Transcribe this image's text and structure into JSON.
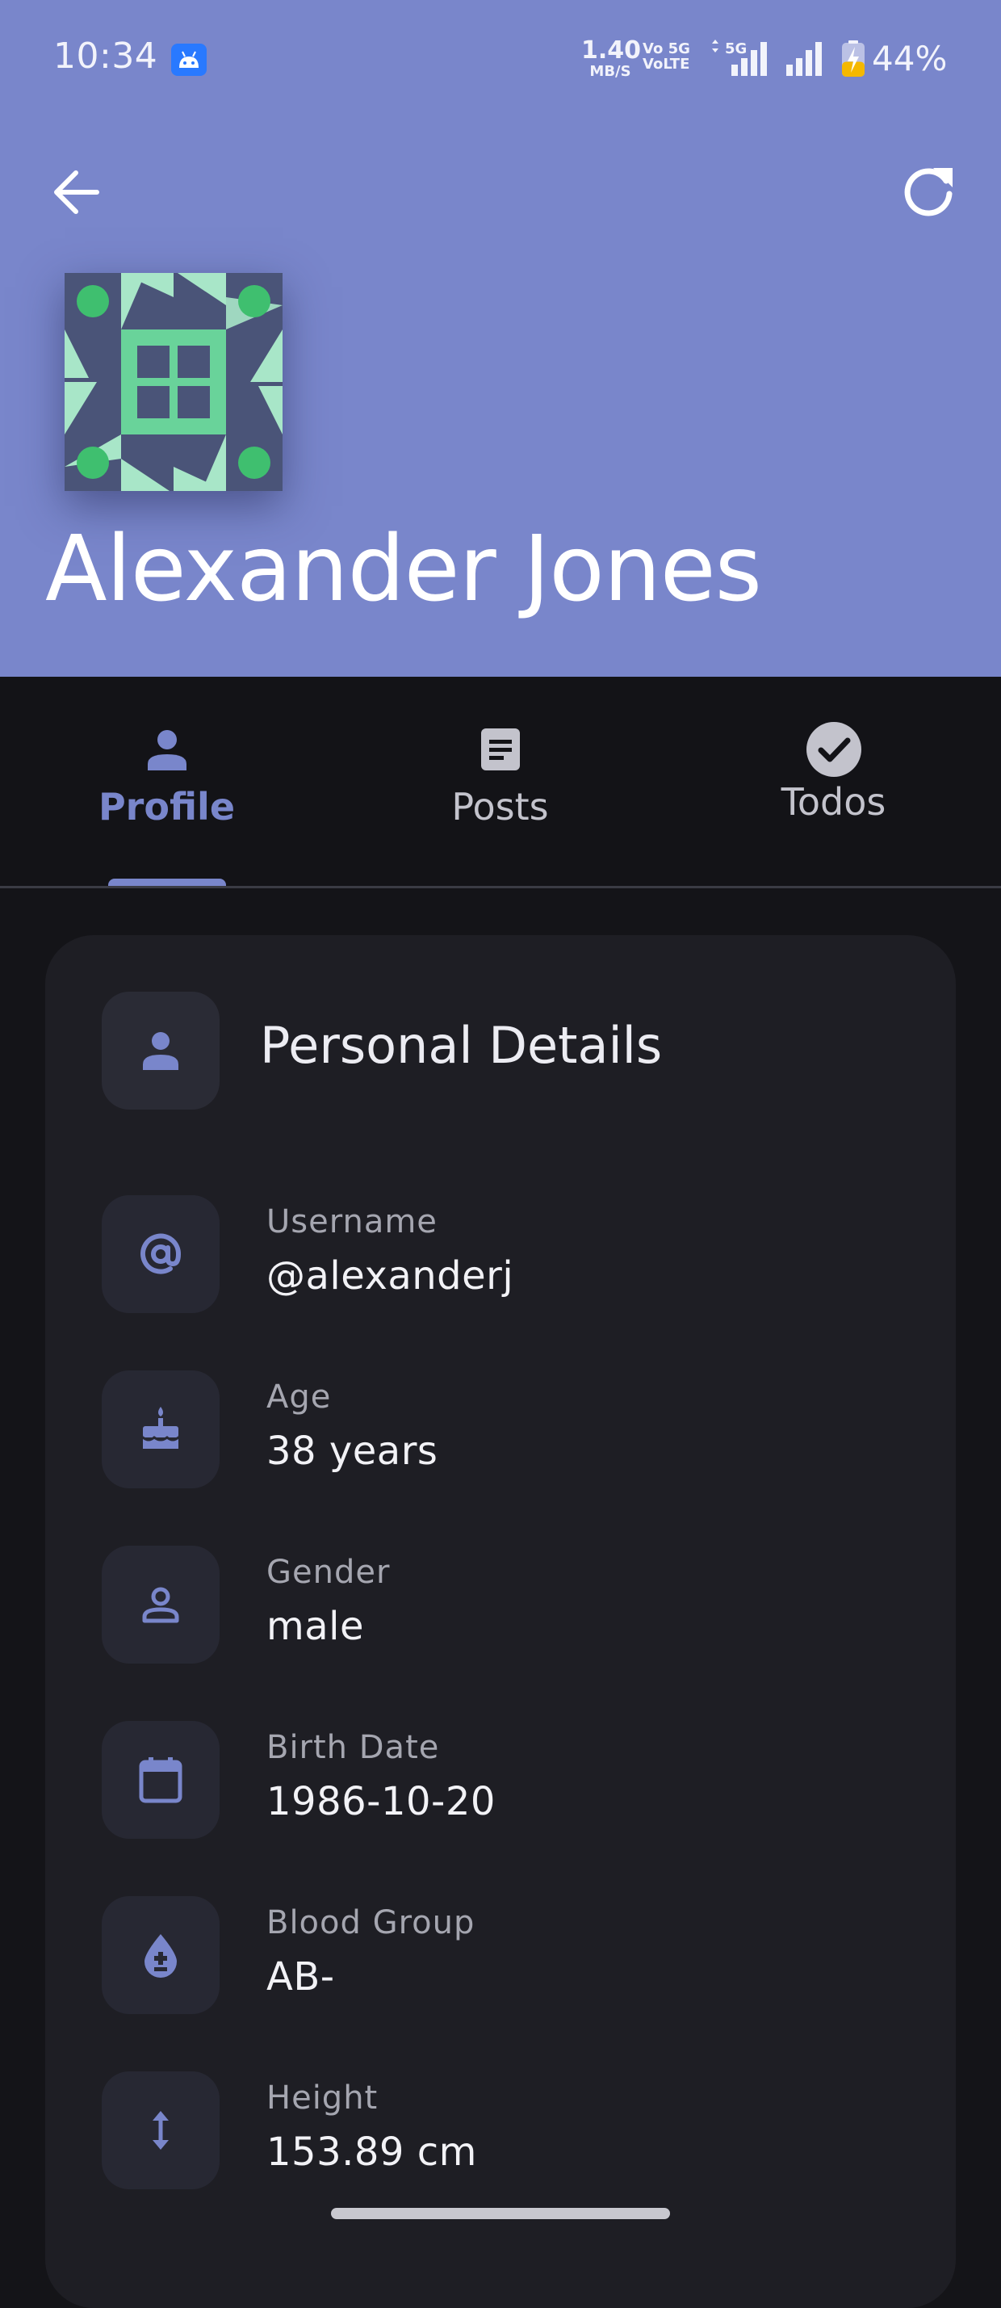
{
  "status_bar": {
    "time": "10:34",
    "speed_value": "1.40",
    "speed_unit": "MB/S",
    "volte_line1": "Vo 5G",
    "volte_line2": "VoLTE",
    "network_5g": "5G",
    "battery_percent": "44%",
    "battery_level": 0.44
  },
  "header": {
    "back_icon": "arrow-left-icon",
    "refresh_icon": "refresh-icon",
    "name": "Alexander Jones",
    "avatar_colors": {
      "primary": "#69d39a",
      "light": "#a8e6c8",
      "bg": "#4a5478"
    }
  },
  "tabs": [
    {
      "label": "Profile",
      "icon": "person-icon",
      "active": true
    },
    {
      "label": "Posts",
      "icon": "article-icon",
      "active": false
    },
    {
      "label": "Todos",
      "icon": "check-circle-icon",
      "active": false
    }
  ],
  "card": {
    "title": "Personal Details",
    "icon": "person-icon",
    "rows": [
      {
        "label": "Username",
        "value": "@alexanderj",
        "icon": "at-icon"
      },
      {
        "label": "Age",
        "value": "38 years",
        "icon": "cake-icon"
      },
      {
        "label": "Gender",
        "value": "male",
        "icon": "person-outline-icon"
      },
      {
        "label": "Birth Date",
        "value": "1986-10-20",
        "icon": "calendar-icon"
      },
      {
        "label": "Blood Group",
        "value": "AB-",
        "icon": "blood-drop-icon"
      },
      {
        "label": "Height",
        "value": "153.89 cm",
        "icon": "height-arrows-icon"
      }
    ]
  },
  "colors": {
    "accent": "#7986cb",
    "background": "#141418",
    "card": "#1e1e24"
  }
}
